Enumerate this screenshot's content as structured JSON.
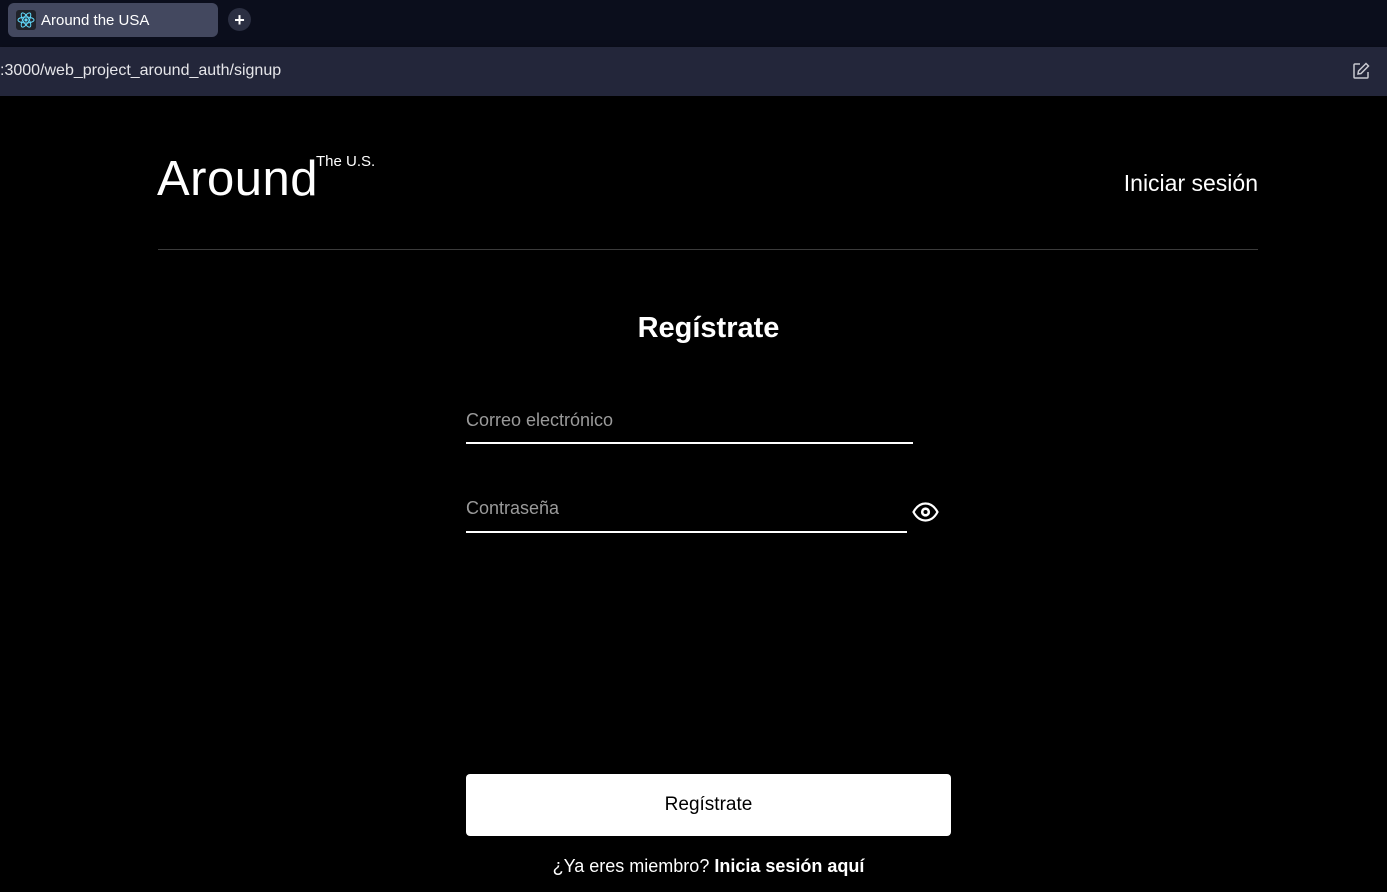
{
  "browser": {
    "tab_title": "Around the USA",
    "tab_icon": "react-icon",
    "new_tab_label": "+",
    "url": ":3000/web_project_around_auth/signup",
    "edit_icon": "edit-icon"
  },
  "header": {
    "logo_main": "Around",
    "logo_sup": "The U.S.",
    "login_link": "Iniciar sesión"
  },
  "form": {
    "title": "Regístrate",
    "email_placeholder": "Correo electrónico",
    "email_value": "",
    "password_placeholder": "Contraseña",
    "password_value": "",
    "toggle_icon": "eye-icon",
    "submit_label": "Regístrate",
    "footer_text": "¿Ya eres miembro?",
    "footer_link": "Inicia sesión aquí"
  },
  "colors": {
    "page_background": "#000000",
    "tabbar": "#0b0e1c",
    "urlbar": "#23263a",
    "active_tab": "#43485f",
    "button_bg": "#ffffff"
  }
}
